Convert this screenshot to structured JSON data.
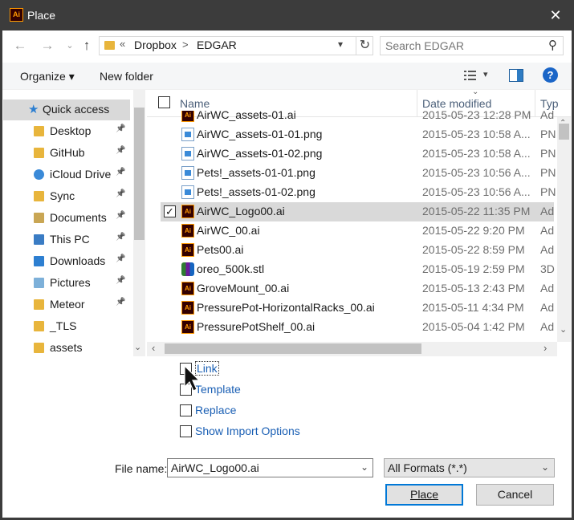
{
  "window": {
    "title": "Place",
    "app_icon_text": "Ai",
    "close_glyph": "✕"
  },
  "address": {
    "overflow_glyph": "«",
    "segments": [
      "Dropbox",
      "EDGAR"
    ],
    "separator": ">",
    "search_placeholder": "Search EDGAR"
  },
  "toolbar": {
    "organize_label": "Organize ▾",
    "new_folder_label": "New folder",
    "help_label": "?"
  },
  "nav": {
    "items": [
      {
        "label": "Quick access",
        "icon": "star-icon",
        "selected": true
      },
      {
        "label": "Desktop",
        "icon": "folder-icon",
        "pinned": true
      },
      {
        "label": "GitHub",
        "icon": "folder-icon",
        "pinned": true
      },
      {
        "label": "iCloud Drive",
        "icon": "cloud-icon",
        "pinned": true
      },
      {
        "label": "Sync",
        "icon": "folder-icon",
        "pinned": true
      },
      {
        "label": "Documents",
        "icon": "documents-icon",
        "pinned": true
      },
      {
        "label": "This PC",
        "icon": "computer-icon",
        "pinned": true
      },
      {
        "label": "Downloads",
        "icon": "downloads-icon",
        "pinned": true
      },
      {
        "label": "Pictures",
        "icon": "pictures-icon",
        "pinned": true
      },
      {
        "label": "Meteor",
        "icon": "folder-icon",
        "pinned": true
      },
      {
        "label": "_TLS",
        "icon": "folder-icon",
        "pinned": false
      },
      {
        "label": "assets",
        "icon": "folder-icon",
        "pinned": false
      }
    ]
  },
  "columns": {
    "name": "Name",
    "date": "Date modified",
    "type": "Typ"
  },
  "files": [
    {
      "name": "AirWC_assets-01.ai",
      "date": "2015-05-23 12:28 PM",
      "type": "Ad",
      "kind": "ai"
    },
    {
      "name": "AirWC_assets-01-01.png",
      "date": "2015-05-23 10:58 A...",
      "type": "PN",
      "kind": "png"
    },
    {
      "name": "AirWC_assets-01-02.png",
      "date": "2015-05-23 10:58 A...",
      "type": "PN",
      "kind": "png"
    },
    {
      "name": "Pets!_assets-01-01.png",
      "date": "2015-05-23 10:56 A...",
      "type": "PN",
      "kind": "png"
    },
    {
      "name": "Pets!_assets-01-02.png",
      "date": "2015-05-23 10:56 A...",
      "type": "PN",
      "kind": "png"
    },
    {
      "name": "AirWC_Logo00.ai",
      "date": "2015-05-22 11:35 PM",
      "type": "Ad",
      "kind": "ai",
      "selected": true
    },
    {
      "name": "AirWC_00.ai",
      "date": "2015-05-22 9:20 PM",
      "type": "Ad",
      "kind": "ai"
    },
    {
      "name": "Pets00.ai",
      "date": "2015-05-22 8:59 PM",
      "type": "Ad",
      "kind": "ai"
    },
    {
      "name": "oreo_500k.stl",
      "date": "2015-05-19 2:59 PM",
      "type": "3D",
      "kind": "stl"
    },
    {
      "name": "GroveMount_00.ai",
      "date": "2015-05-13 2:43 PM",
      "type": "Ad",
      "kind": "ai"
    },
    {
      "name": "PressurePot-HorizontalRacks_00.ai",
      "date": "2015-05-11 4:34 PM",
      "type": "Ad",
      "kind": "ai"
    },
    {
      "name": "PressurePotShelf_00.ai",
      "date": "2015-05-04 1:42 PM",
      "type": "Ad",
      "kind": "ai"
    }
  ],
  "options": {
    "link": "Link",
    "template": "Template",
    "replace": "Replace",
    "show_import": "Show Import Options"
  },
  "footer": {
    "filename_label": "File name:",
    "filename_value": "AirWC_Logo00.ai",
    "format_value": "All Formats (*.*)",
    "place_label": "Place",
    "cancel_label": "Cancel"
  },
  "colors": {
    "titlebar": "#3c3c3c",
    "selection": "#d9d9d9",
    "link_blue": "#1a5fb4",
    "accent": "#0078d7"
  }
}
